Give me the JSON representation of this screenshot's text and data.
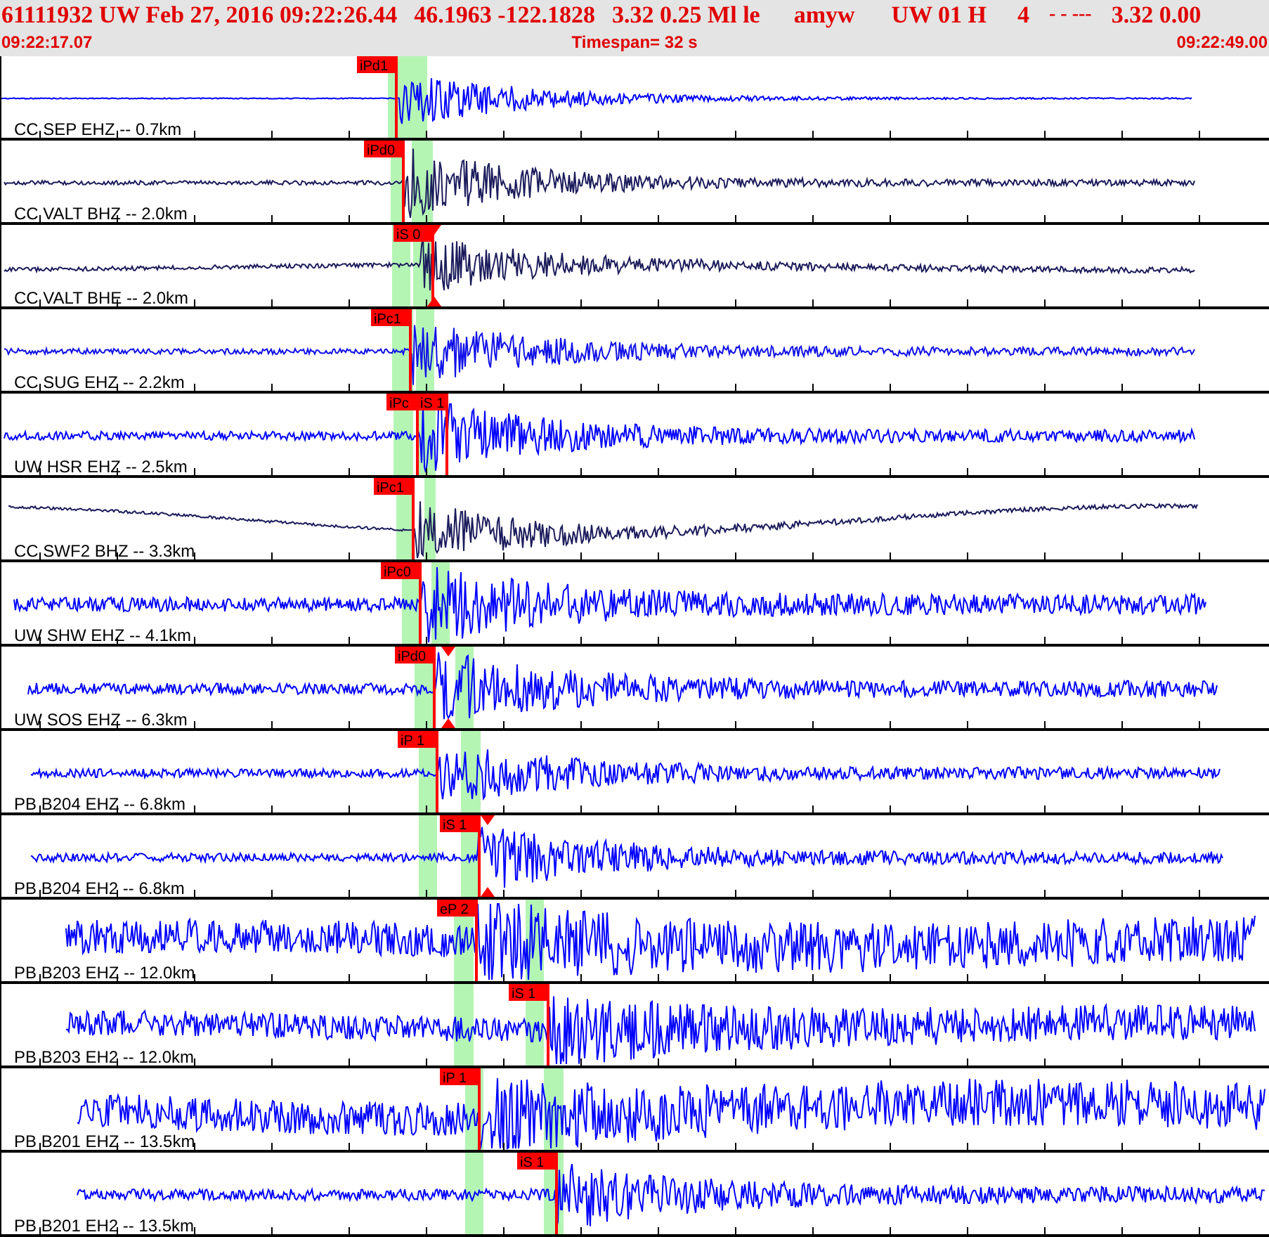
{
  "header": {
    "fields": [
      "61111932 UW Feb 27, 2016 09:22:26.44",
      "46.1963 -122.1828",
      "3.32 0.25 Ml le",
      "amyw",
      "UW 01 H",
      "4",
      "- - ---",
      "3.32 0.00"
    ],
    "start_time": "09:22:17.07",
    "timespan": "Timespan=  32 s",
    "end_time": "09:22:49.00"
  },
  "traces": [
    {
      "label": "CC SEP EHZ -- 0.7km",
      "color": "#0000ff",
      "picks": [
        {
          "label": "iPd1",
          "marker": false
        }
      ]
    },
    {
      "label": "CC VALT BHZ -- 2.0km",
      "color": "#1c1c5c",
      "picks": [
        {
          "label": "iPd0",
          "marker": false
        }
      ]
    },
    {
      "label": "CC VALT BHE -- 2.0km",
      "color": "#1c1c5c",
      "picks": [
        {
          "label": "iS 0",
          "marker": true
        }
      ]
    },
    {
      "label": "CC SUG EHZ -- 2.2km",
      "color": "#1010e8",
      "picks": [
        {
          "label": "iPc1",
          "marker": false
        }
      ]
    },
    {
      "label": "UW HSR EHZ -- 2.5km",
      "color": "#0000ff",
      "picks": [
        {
          "label": "iPc",
          "marker": false
        },
        {
          "label": "iS 1",
          "marker": false
        }
      ]
    },
    {
      "label": "CC SWF2 BHZ -- 3.3km",
      "color": "#1c1c5c",
      "picks": [
        {
          "label": "iPc1",
          "marker": false
        }
      ]
    },
    {
      "label": "UW SHW EHZ -- 4.1km",
      "color": "#0000ff",
      "picks": [
        {
          "label": "iPc0",
          "marker": false
        }
      ]
    },
    {
      "label": "UW SOS EHZ -- 6.3km",
      "color": "#0000ff",
      "picks": [
        {
          "label": "iPd0",
          "marker": true
        }
      ]
    },
    {
      "label": "PB B204 EHZ -- 6.8km",
      "color": "#0000ff",
      "picks": [
        {
          "label": "iP 1",
          "marker": false
        }
      ]
    },
    {
      "label": "PB B204 EH2 -- 6.8km",
      "color": "#0000ff",
      "picks": [
        {
          "label": "iS 1",
          "marker": true
        }
      ]
    },
    {
      "label": "PB B203 EHZ -- 12.0km",
      "color": "#0000ff",
      "picks": [
        {
          "label": "eP 2",
          "marker": false
        }
      ]
    },
    {
      "label": "PB B203 EH2 -- 12.0km",
      "color": "#0000ff",
      "picks": [
        {
          "label": "iS 1",
          "marker": false
        }
      ]
    },
    {
      "label": "PB B201 EHZ -- 13.5km",
      "color": "#0000ff",
      "picks": [
        {
          "label": "iP 1",
          "marker": false
        }
      ]
    },
    {
      "label": "PB B201 EH2 -- 13.5km",
      "color": "#0000ff",
      "picks": [
        {
          "label": "iS 1",
          "marker": false
        }
      ]
    }
  ]
}
